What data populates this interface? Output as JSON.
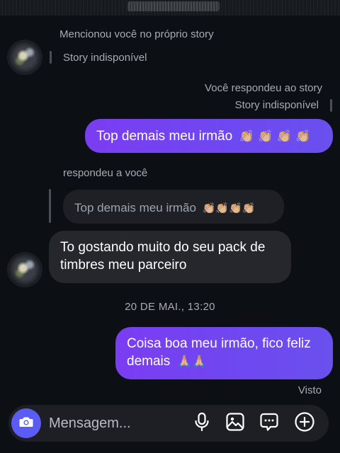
{
  "thread": {
    "mention_caption": "Mencionou você no próprio story",
    "story_unavailable_1": "Story indisponível",
    "you_replied_caption": "Você respondeu ao story",
    "story_unavailable_2": "Story indisponível",
    "sent_message_1": "Top demais meu irmão",
    "sent_message_1_emoji": "👏🏼 👏🏼 👏🏼 👏🏼",
    "replied_to_you_caption": "respondeu a você",
    "quoted_text": "Top demais meu irmão",
    "quoted_emoji": "👏🏼👏🏼👏🏼👏🏼",
    "received_message": "To gostando muito do seu pack de timbres meu parceiro",
    "date_separator": "20 DE MAI., 13:20",
    "sent_message_2": "Coisa boa meu irmão, fico feliz demais",
    "sent_message_2_emoji": "🙏🏼🙏🏼",
    "seen_status": "Visto"
  },
  "composer": {
    "placeholder": "Mensagem...",
    "icons": [
      "camera-icon",
      "microphone-icon",
      "image-icon",
      "sticker-icon",
      "plus-circle-icon"
    ]
  },
  "colors": {
    "background": "#0c0f14",
    "sent_bubble": "#7047f0",
    "received_bubble": "#25272c",
    "camera_button": "#5b5cf4"
  }
}
